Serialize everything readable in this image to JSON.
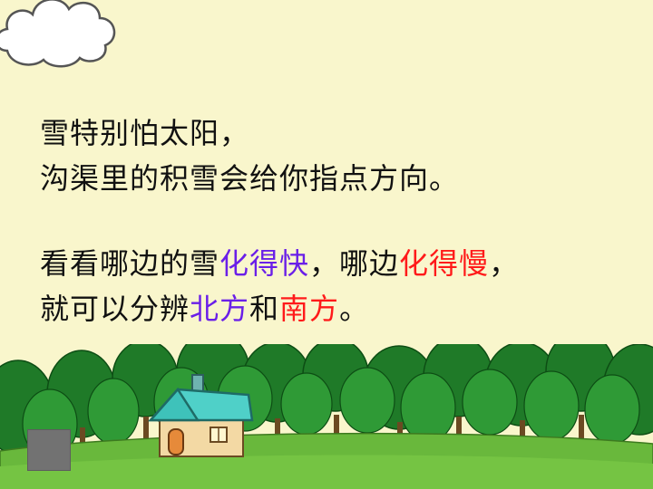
{
  "slide": {
    "block1": {
      "line1": "雪特别怕太阳，",
      "line2": "沟渠里的积雪会给你指点方向。"
    },
    "block2": {
      "line1_a": "看看哪边的雪",
      "line1_b": "化得快",
      "line1_c": "，哪边",
      "line1_d": "化得慢",
      "line1_e": "，",
      "line2_a": "就可以分辨",
      "line2_b": "北方",
      "line2_c": "和",
      "line2_d": "南方",
      "line2_e": "。"
    },
    "colors": {
      "text": "#111111",
      "highlight_purple": "#6a1fe8",
      "highlight_red": "#ff1a1a",
      "background": "#f9f6cc",
      "grass": "#6ab83c",
      "trees": "#2e8b2e"
    },
    "icons": [
      "cloud-icon",
      "house-icon",
      "trees-illustration"
    ]
  }
}
